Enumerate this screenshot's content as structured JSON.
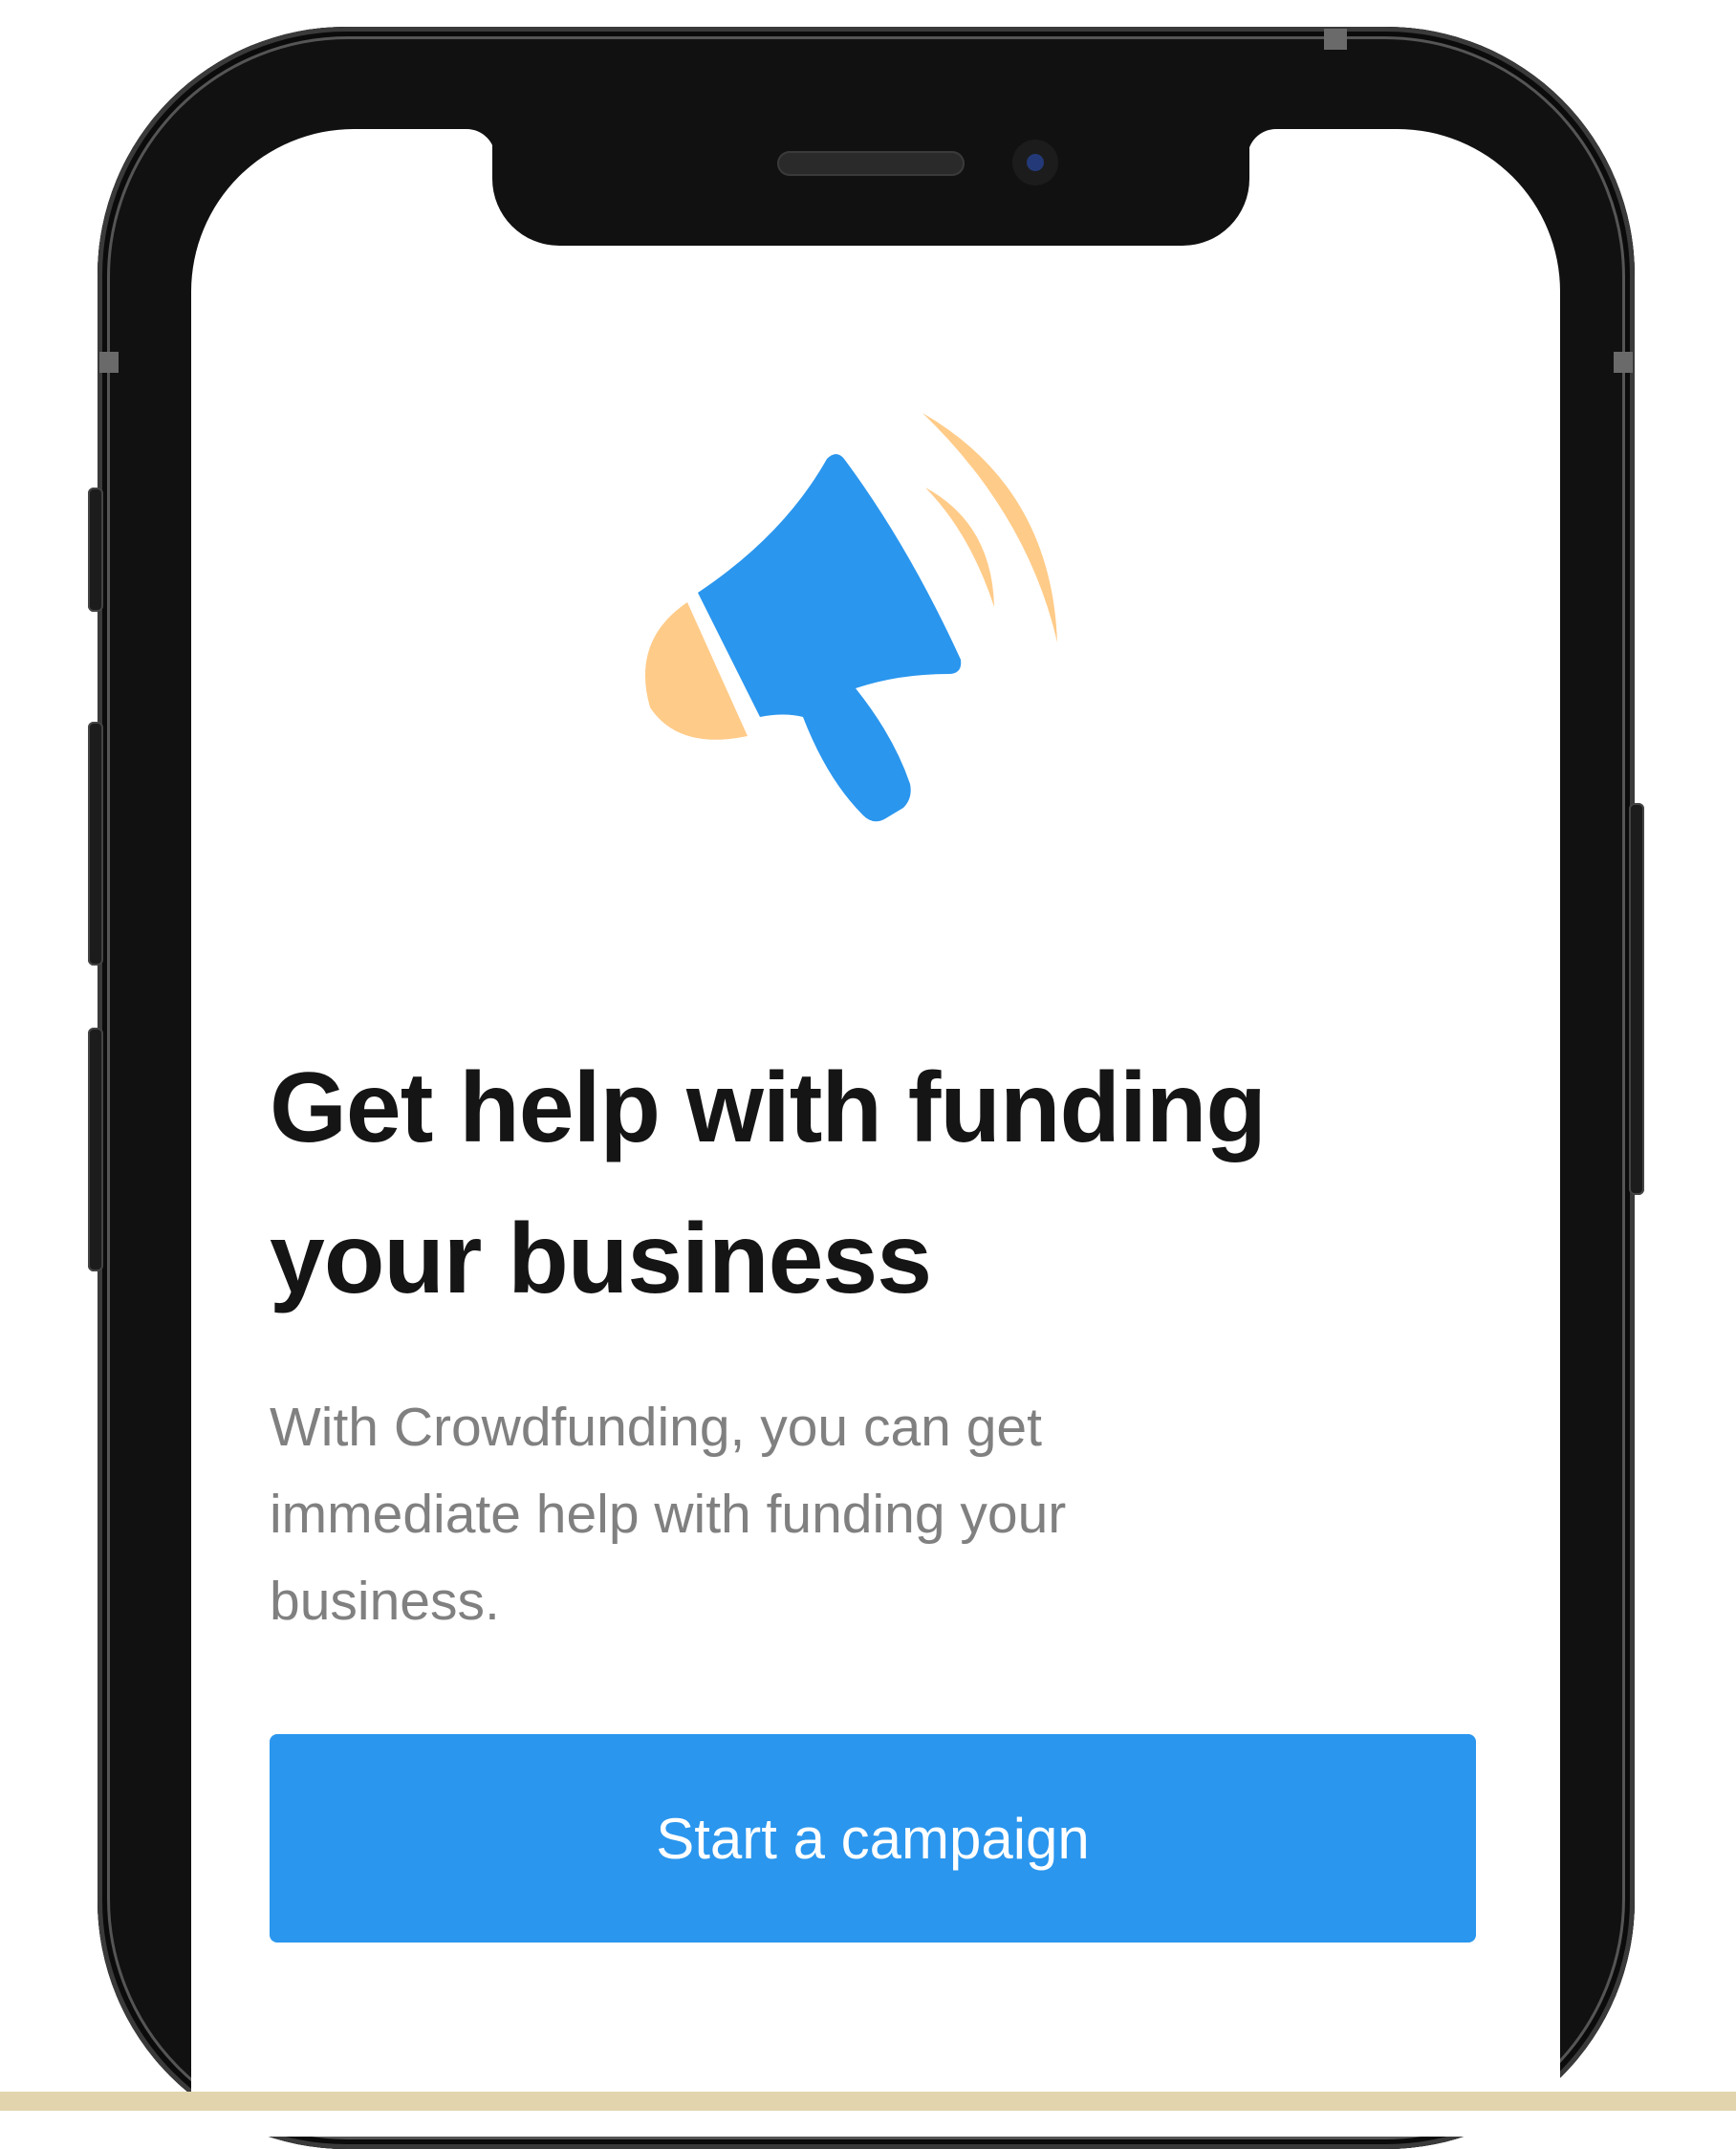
{
  "colors": {
    "primary": "#2a96ee",
    "megaphone_blue": "#2a96ee",
    "accent_orange": "#ffcb88",
    "headline_text": "#151515",
    "body_text": "#808080",
    "button_text": "#ffffff",
    "device_frame": "#111111",
    "floor": "#e2d4ad"
  },
  "illustration": {
    "icon": "megaphone-icon"
  },
  "content": {
    "headline_line1": "Get help with funding",
    "headline_line2": "your business",
    "body": "With Crowdfunding, you can get immediate help with funding your business."
  },
  "actions": {
    "start_campaign_label": "Start a campaign"
  }
}
